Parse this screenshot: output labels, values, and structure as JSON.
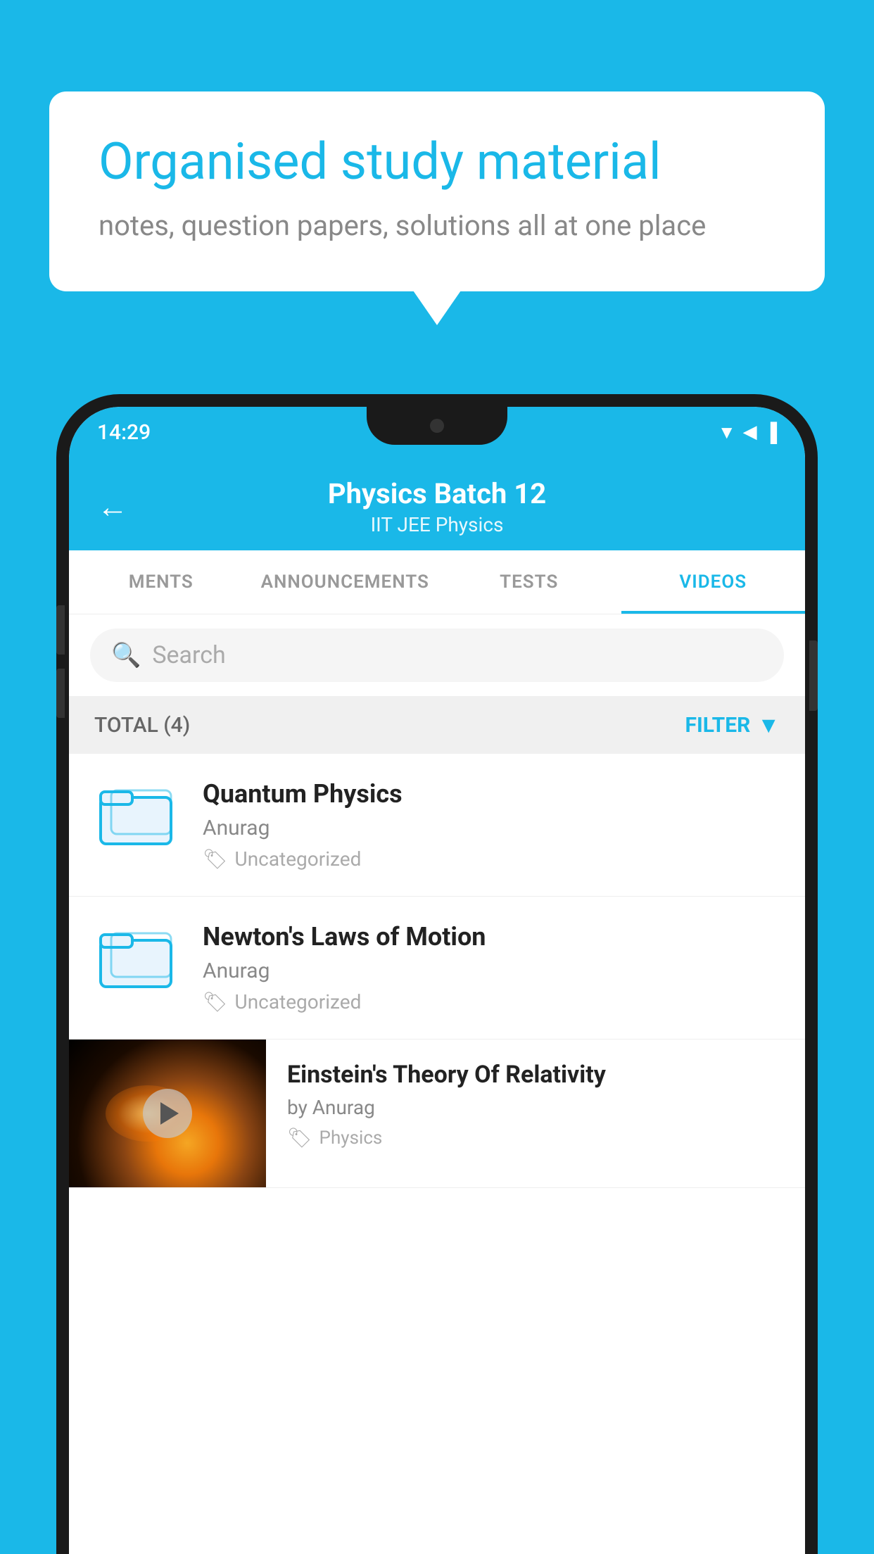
{
  "background_color": "#1ab8e8",
  "speech_bubble": {
    "headline": "Organised study material",
    "subtext": "notes, question papers, solutions all at one place"
  },
  "phone": {
    "status_bar": {
      "time": "14:29",
      "icons": "▼◀▐"
    },
    "header": {
      "back_label": "←",
      "title": "Physics Batch 12",
      "subtitle": "IIT JEE   Physics"
    },
    "tabs": [
      {
        "label": "MENTS",
        "active": false
      },
      {
        "label": "ANNOUNCEMENTS",
        "active": false
      },
      {
        "label": "TESTS",
        "active": false
      },
      {
        "label": "VIDEOS",
        "active": true
      }
    ],
    "search": {
      "placeholder": "Search"
    },
    "filter_bar": {
      "total_label": "TOTAL (4)",
      "filter_label": "FILTER"
    },
    "videos": [
      {
        "id": "quantum",
        "title": "Quantum Physics",
        "author": "Anurag",
        "tag": "Uncategorized",
        "has_thumbnail": false
      },
      {
        "id": "newton",
        "title": "Newton's Laws of Motion",
        "author": "Anurag",
        "tag": "Uncategorized",
        "has_thumbnail": false
      },
      {
        "id": "einstein",
        "title": "Einstein's Theory Of Relativity",
        "author": "by Anurag",
        "tag": "Physics",
        "has_thumbnail": true
      }
    ]
  }
}
